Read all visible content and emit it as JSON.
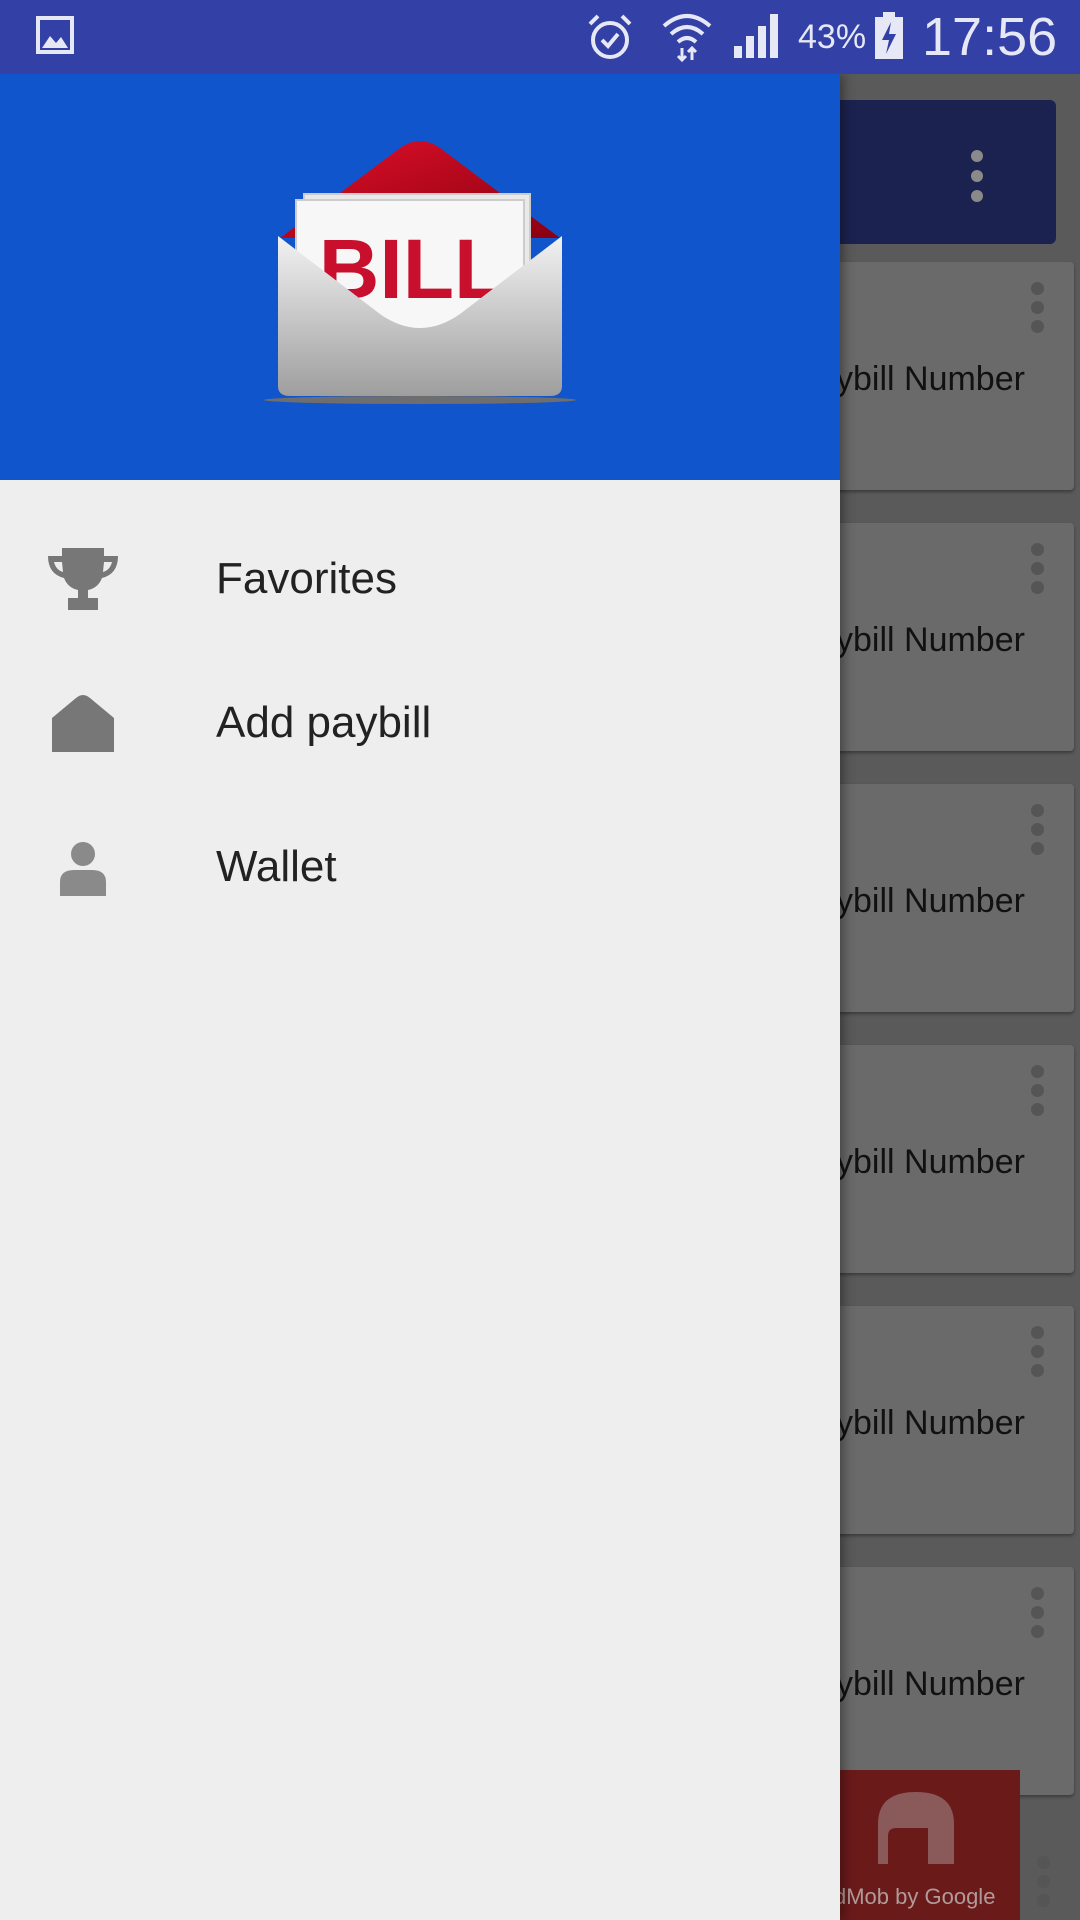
{
  "status_bar": {
    "battery_percent": "43%",
    "time": "17:56"
  },
  "drawer": {
    "header": {
      "logo_text": "BILL",
      "background_color": "#1155cc"
    },
    "items": [
      {
        "label": "Favorites",
        "icon": "trophy-icon"
      },
      {
        "label": "Add paybill",
        "icon": "envelope-icon"
      },
      {
        "label": "Wallet",
        "icon": "person-icon"
      }
    ]
  },
  "background_list": {
    "cards": [
      {
        "text": "ybill Number"
      },
      {
        "text": "ybill Number"
      },
      {
        "text": "ybill Number"
      },
      {
        "text": "ybill Number"
      },
      {
        "text": "ybill Number"
      },
      {
        "text": "ybill Number"
      }
    ],
    "ad": {
      "text": "dMob by Google"
    }
  }
}
